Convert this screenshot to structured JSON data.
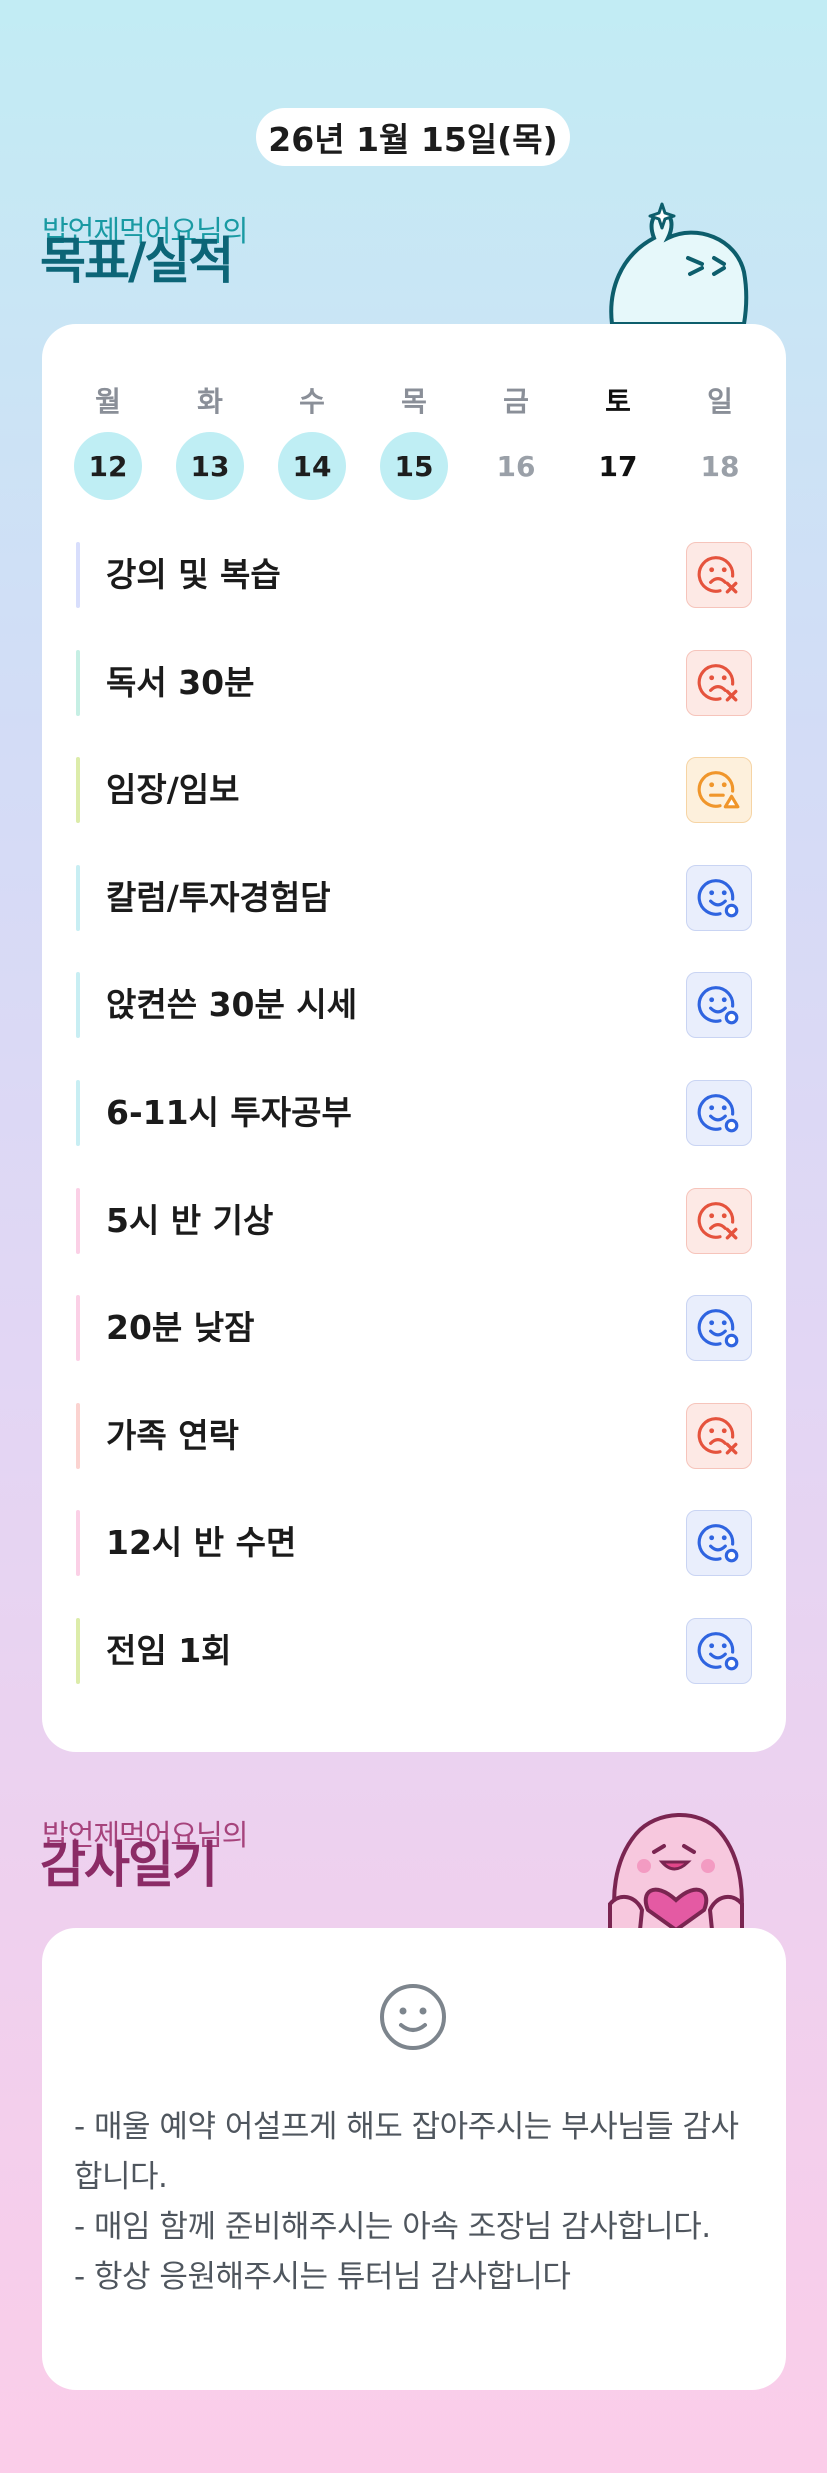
{
  "date_label": "26년 1월 15일(목)",
  "goals_section": {
    "subtitle": "밥언제먹어요님의",
    "title": "목표/실적"
  },
  "week": [
    {
      "day": "월",
      "date": "12",
      "state": "done"
    },
    {
      "day": "화",
      "date": "13",
      "state": "done"
    },
    {
      "day": "수",
      "date": "14",
      "state": "done"
    },
    {
      "day": "목",
      "date": "15",
      "state": "done"
    },
    {
      "day": "금",
      "date": "16",
      "state": "future"
    },
    {
      "day": "토",
      "date": "17",
      "state": "today"
    },
    {
      "day": "일",
      "date": "18",
      "state": "future"
    }
  ],
  "goals": [
    {
      "label": "강의 및 복습",
      "status": "fail",
      "bar_color": "#d8defc"
    },
    {
      "label": "독서 30분",
      "status": "fail",
      "bar_color": "#c6efe4"
    },
    {
      "label": "임장/임보",
      "status": "warn",
      "bar_color": "#dcecaa"
    },
    {
      "label": "칼럼/투자경험담",
      "status": "ok",
      "bar_color": "#c8eef3"
    },
    {
      "label": "앉켠쓴 30분 시세",
      "status": "ok",
      "bar_color": "#c8eef3"
    },
    {
      "label": "6-11시 투자공부",
      "status": "ok",
      "bar_color": "#c8eef3"
    },
    {
      "label": "5시 반 기상",
      "status": "fail",
      "bar_color": "#fbd0e6"
    },
    {
      "label": "20분 낮잠",
      "status": "ok",
      "bar_color": "#fbd0e6"
    },
    {
      "label": "가족 연락",
      "status": "fail",
      "bar_color": "#fbd3d0"
    },
    {
      "label": "12시 반 수면",
      "status": "ok",
      "bar_color": "#fbd0e6"
    },
    {
      "label": "전임 1회",
      "status": "ok",
      "bar_color": "#dcecaa"
    }
  ],
  "status_icons": {
    "fail": "sad-x-face-icon",
    "warn": "neutral-triangle-face-icon",
    "ok": "smile-circle-face-icon"
  },
  "status_colors": {
    "fail": "#e5533d",
    "warn": "#f0962b",
    "ok": "#2f64e0"
  },
  "gratitude_section": {
    "subtitle": "밥언제먹어요님의",
    "title": "감사일기"
  },
  "gratitude": {
    "icon": "smile-face-icon",
    "lines": [
      "- 매울 예약 어설프게 해도 잡아주시는 부사님들 감사합니다.",
      "- 매임 함께 준비해주시는 아속 조장님 감사합니다.",
      "- 항상 응원해주시는 튜터님 감사합니다"
    ]
  }
}
